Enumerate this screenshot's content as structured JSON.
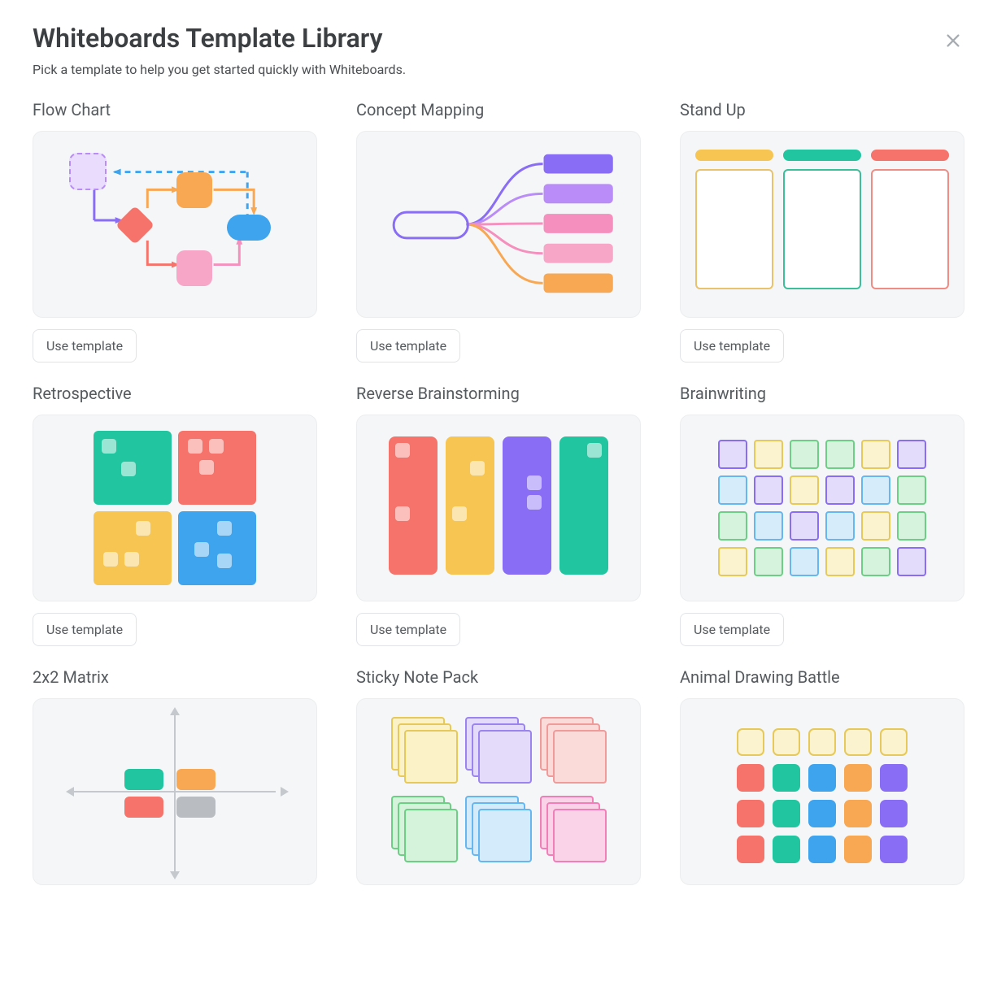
{
  "header": {
    "title": "Whiteboards Template Library",
    "subtitle": "Pick a template to help you get started quickly with Whiteboards."
  },
  "button_label": "Use template",
  "templates": [
    {
      "id": "flow-chart",
      "name": "Flow Chart"
    },
    {
      "id": "concept-mapping",
      "name": "Concept Mapping"
    },
    {
      "id": "stand-up",
      "name": "Stand Up"
    },
    {
      "id": "retrospective",
      "name": "Retrospective"
    },
    {
      "id": "reverse-brainstorming",
      "name": "Reverse Brainstorming"
    },
    {
      "id": "brainwriting",
      "name": "Brainwriting"
    },
    {
      "id": "2x2-matrix",
      "name": "2x2 Matrix"
    },
    {
      "id": "sticky-note-pack",
      "name": "Sticky Note Pack"
    },
    {
      "id": "animal-drawing-battle",
      "name": "Animal Drawing Battle"
    }
  ],
  "colors": {
    "teal": "#21c6a0",
    "red": "#f5736a",
    "yellow": "#f6c552",
    "blue": "#3ea4ee",
    "purple": "#8a6df5",
    "violet": "#b98cf7",
    "pink": "#f58fbd",
    "orange": "#f8a752",
    "green": "#a1e8b0",
    "lightyellow": "#f5eeb6",
    "lavender": "#cabff5",
    "lightblue": "#b3d7f5",
    "gray": "#b9bdc1"
  }
}
